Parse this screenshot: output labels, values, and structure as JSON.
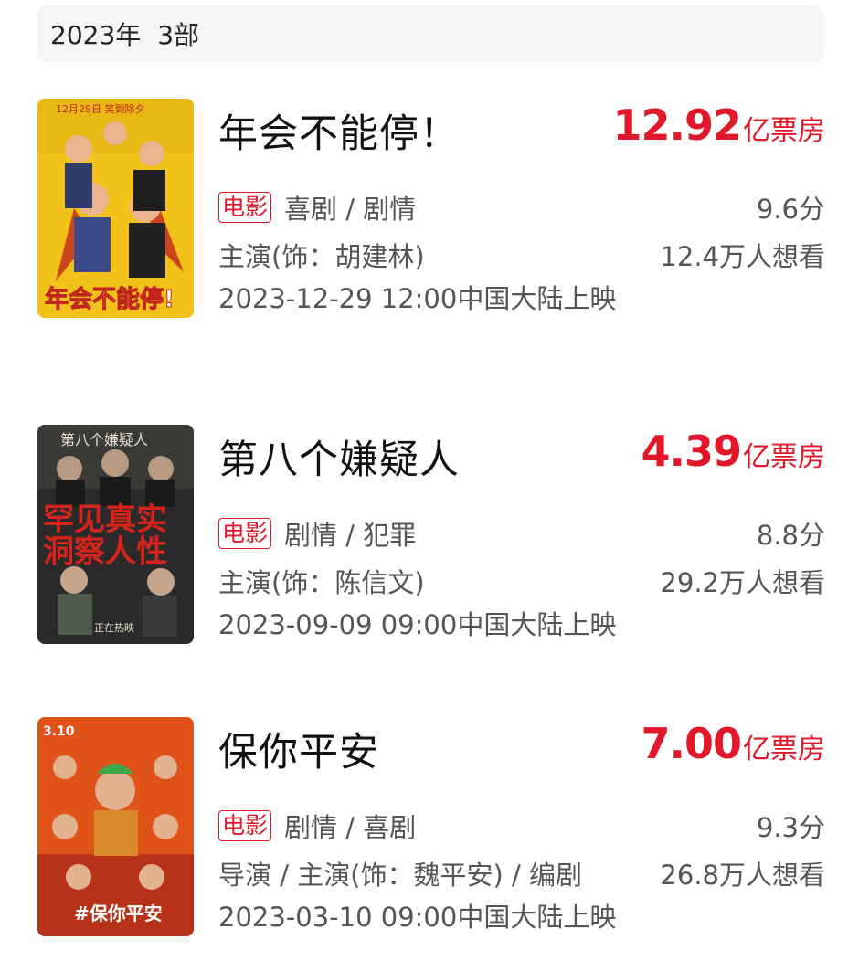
{
  "header": {
    "year": "2023年",
    "count": "3部"
  },
  "movies": [
    {
      "title": "年会不能停！",
      "box_office_value": "12.92",
      "box_office_unit": "亿票房",
      "badge": "电影",
      "genres": "喜剧 / 剧情",
      "score": "9.6分",
      "cast": "主演(饰：胡建林)",
      "want": "12.4万人想看",
      "release": "2023-12-29 12:00中国大陆上映",
      "poster_title": "年会不能停!",
      "poster_top": "12月29日 笑到除夕"
    },
    {
      "title": "第八个嫌疑人",
      "box_office_value": "4.39",
      "box_office_unit": "亿票房",
      "badge": "电影",
      "genres": "剧情 / 犯罪",
      "score": "8.8分",
      "cast": "主演(饰：陈信文)",
      "want": "29.2万人想看",
      "release": "2023-09-09 09:00中国大陆上映",
      "poster_title": "第八个嫌疑人",
      "poster_slogan_1": "罕见真实",
      "poster_slogan_2": "洞察人性",
      "poster_bottom": "正在热映"
    },
    {
      "title": "保你平安",
      "box_office_value": "7.00",
      "box_office_unit": "亿票房",
      "badge": "电影",
      "genres": "剧情 / 喜剧",
      "score": "9.3分",
      "cast": "导演 / 主演(饰：魏平安) / 编剧",
      "want": "26.8万人想看",
      "release": "2023-03-10 09:00中国大陆上映",
      "poster_title": "#保你平安",
      "poster_date": "3.10"
    }
  ],
  "colors": {
    "accent_red": "#e0182a",
    "header_bg": "#f5f5f7"
  }
}
